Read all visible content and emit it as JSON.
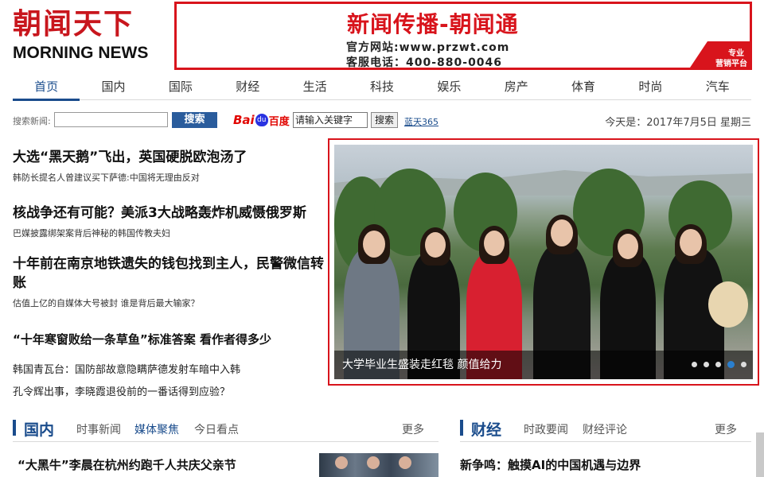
{
  "logo": {
    "cn": "朝闻天下",
    "en": "MORNING NEWS"
  },
  "ad": {
    "title": "新闻传播-朝闻通",
    "line1": "官方网站:www.przwt.com",
    "line2": "客服电话：400-880-0046",
    "corner1": "专业",
    "corner2": "营销平台",
    "accent": "#d8141c"
  },
  "nav": {
    "items": [
      "首页",
      "国内",
      "国际",
      "财经",
      "生活",
      "科技",
      "娱乐",
      "房产",
      "体育",
      "时尚",
      "汽车"
    ],
    "active_index": 0,
    "accent": "#1a4c8c"
  },
  "search": {
    "label": "搜索新闻:",
    "value": "",
    "button": "搜索",
    "baidu_bai": "Bai",
    "baidu_paw": "du",
    "baidu_du": "百度",
    "baidu_value": "请输入关键字",
    "baidu_button": "搜索",
    "lantian": "蓝天365",
    "today": "今天是：2017年7月5日 星期三"
  },
  "headlines": [
    {
      "title": "大选“黑天鹅”飞出，英国硬脱欧泡汤了",
      "sub": "韩防长提名人曾建议买下萨德:中国将无理由反对"
    },
    {
      "title": "核战争还有可能？美派3大战略轰炸机威慑俄罗斯",
      "sub": "巴媒披露绑架案背后神秘的韩国传教夫妇"
    },
    {
      "title": "十年前在南京地铁遗失的钱包找到主人，民警微信转账",
      "sub": "估值上亿的自媒体大号被封 谁是背后最大输家？"
    },
    {
      "title": "“十年寒窗败给一条草鱼”标准答案 看作者得多少"
    },
    {
      "title": "韩国青瓦台：国防部故意隐瞒萨德发射车暗中入韩"
    },
    {
      "title": "孔令辉出事，李晓霞退役前的一番话得到应验？"
    }
  ],
  "slider": {
    "caption": "大学毕业生盛装走红毯 颜值给力",
    "dots": 5,
    "active_dot": 3
  },
  "sections": {
    "domestic": {
      "title": "国内",
      "tabs": [
        "时事新闻",
        "媒体聚焦",
        "今日看点"
      ],
      "more": "更多",
      "headline": "“大黑牛”李晨在杭州约跑千人共庆父亲节"
    },
    "finance": {
      "title": "财经",
      "tabs": [
        "时政要闻",
        "财经评论"
      ],
      "more": "更多",
      "headline": "新争鸣：触摸AI的中国机遇与边界"
    }
  }
}
